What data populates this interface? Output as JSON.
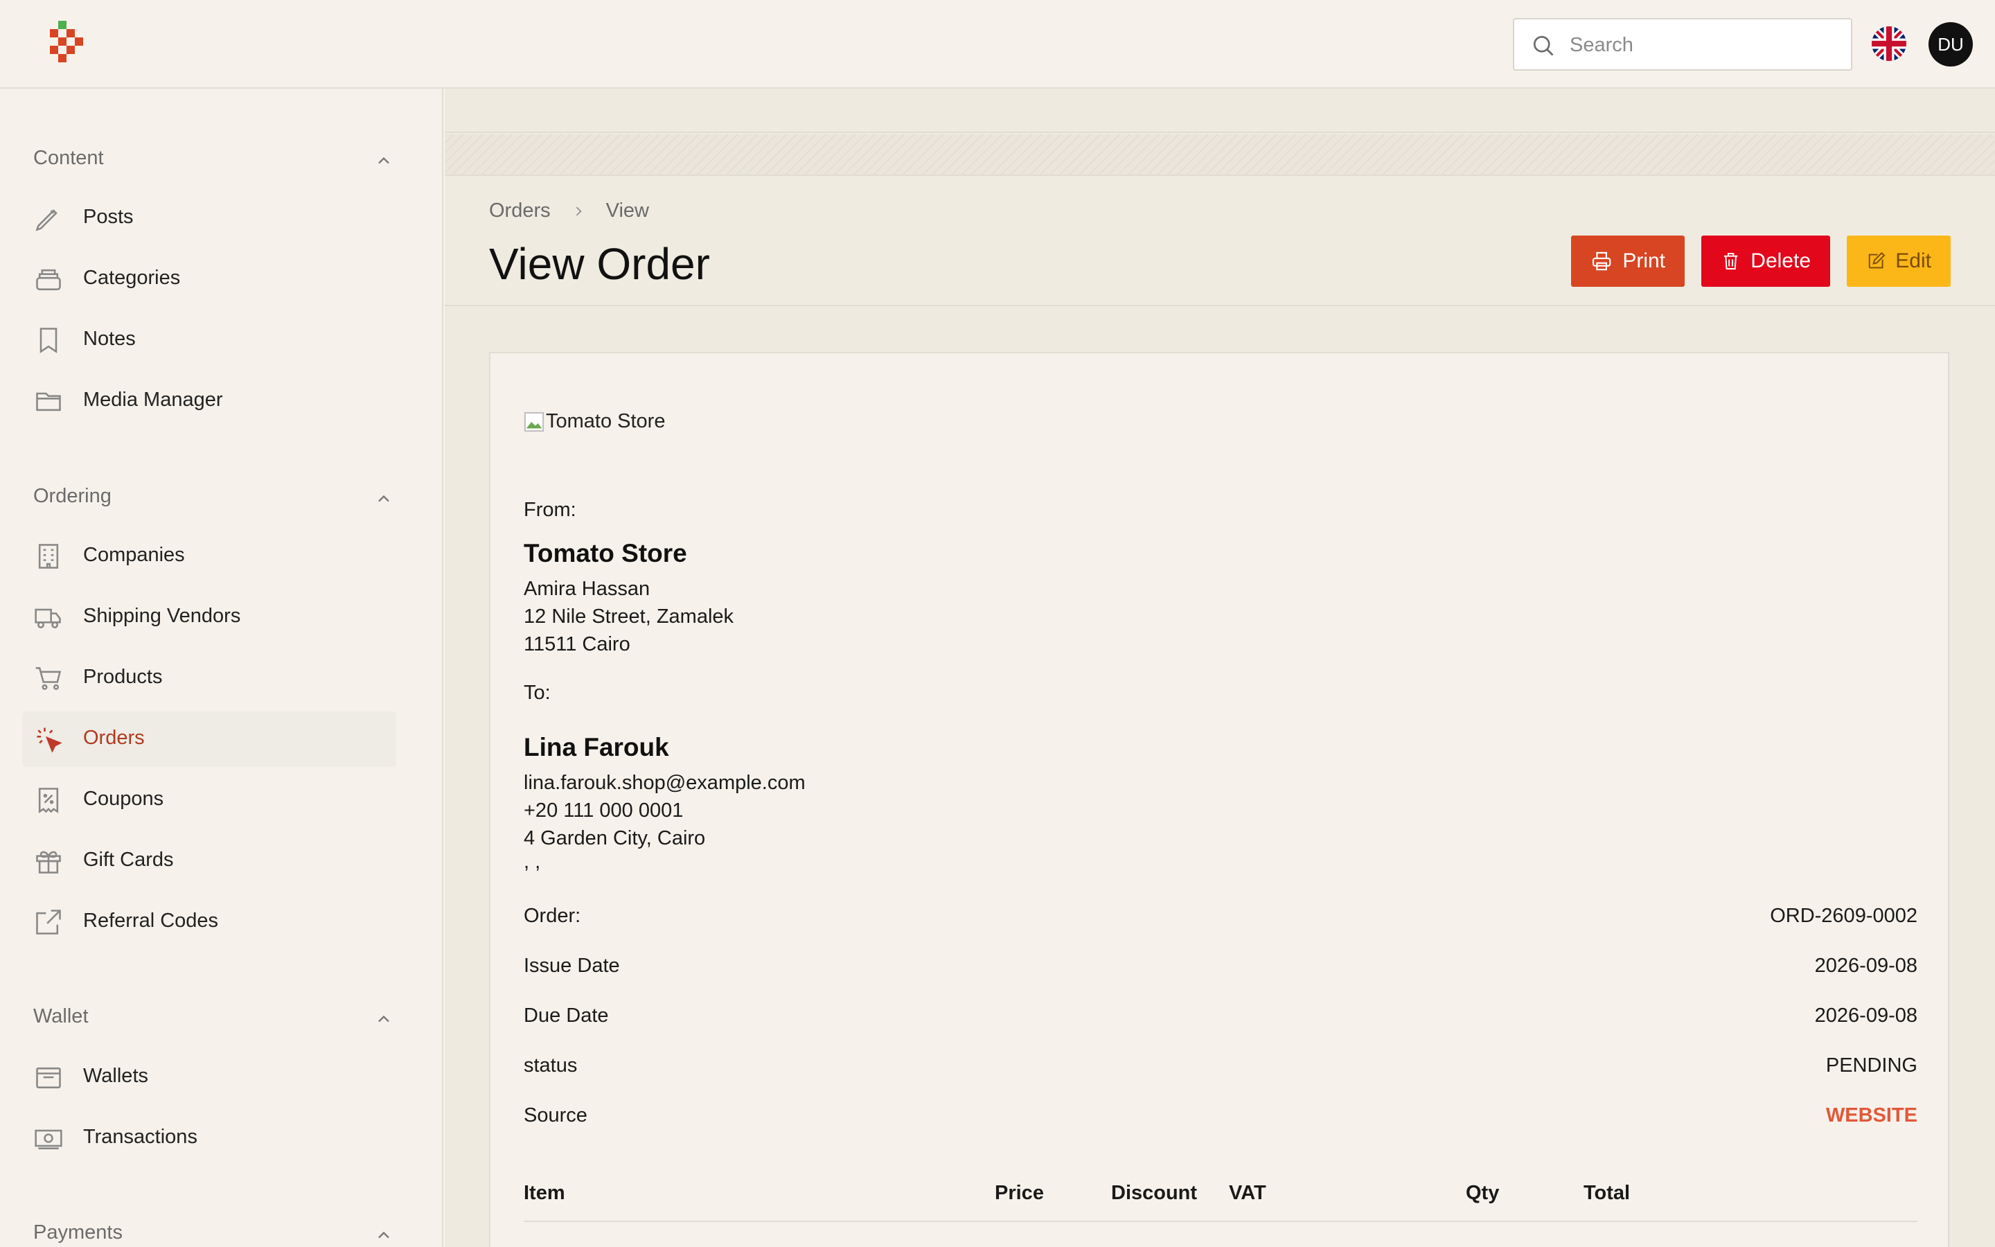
{
  "header": {
    "search": {
      "placeholder": "Search"
    },
    "language_icon": "uk-flag-icon",
    "avatar_initials": "DU"
  },
  "sidebar": {
    "sections": [
      {
        "title": "Content",
        "items": [
          {
            "label": "Posts",
            "icon": "pencil-icon"
          },
          {
            "label": "Categories",
            "icon": "stack-icon"
          },
          {
            "label": "Notes",
            "icon": "bookmark-icon"
          },
          {
            "label": "Media Manager",
            "icon": "folder-icon"
          }
        ]
      },
      {
        "title": "Ordering",
        "items": [
          {
            "label": "Companies",
            "icon": "building-icon"
          },
          {
            "label": "Shipping Vendors",
            "icon": "truck-icon"
          },
          {
            "label": "Products",
            "icon": "cart-icon"
          },
          {
            "label": "Orders",
            "icon": "cursor-click-icon",
            "active": true
          },
          {
            "label": "Coupons",
            "icon": "receipt-percent-icon"
          },
          {
            "label": "Gift Cards",
            "icon": "gift-icon"
          },
          {
            "label": "Referral Codes",
            "icon": "external-link-icon"
          }
        ]
      },
      {
        "title": "Wallet",
        "items": [
          {
            "label": "Wallets",
            "icon": "wallet-icon"
          },
          {
            "label": "Transactions",
            "icon": "banknotes-icon"
          }
        ]
      },
      {
        "title": "Payments",
        "items": []
      }
    ]
  },
  "page": {
    "breadcrumb": [
      "Orders",
      "View"
    ],
    "title": "View Order",
    "actions": {
      "print": "Print",
      "delete": "Delete",
      "edit": "Edit"
    }
  },
  "invoice": {
    "logo_alt": "Tomato Store",
    "from_label": "From:",
    "from": {
      "name": "Tomato Store",
      "lines": [
        "Amira Hassan",
        "12 Nile Street, Zamalek",
        "11511 Cairo"
      ]
    },
    "to_label": "To:",
    "to": {
      "name": "Lina Farouk",
      "lines": [
        "lina.farouk.shop@example.com",
        "+20 111 000 0001",
        "4 Garden City, Cairo",
        ", ,"
      ]
    },
    "details": [
      {
        "key": "Order:",
        "value": "ORD-2609-0002"
      },
      {
        "key": "Issue Date",
        "value": "2026-09-08"
      },
      {
        "key": "Due Date",
        "value": "2026-09-08"
      },
      {
        "key": "status",
        "value": "PENDING"
      },
      {
        "key": "Source",
        "value": "WEBSITE"
      }
    ],
    "table_headers": [
      "Item",
      "Price",
      "Discount",
      "VAT",
      "Qty",
      "Total"
    ]
  },
  "colors": {
    "accent": "#b13a1f",
    "print": "#d84522",
    "delete": "#e2071b",
    "edit": "#fbb718",
    "source": "#e2583a"
  }
}
